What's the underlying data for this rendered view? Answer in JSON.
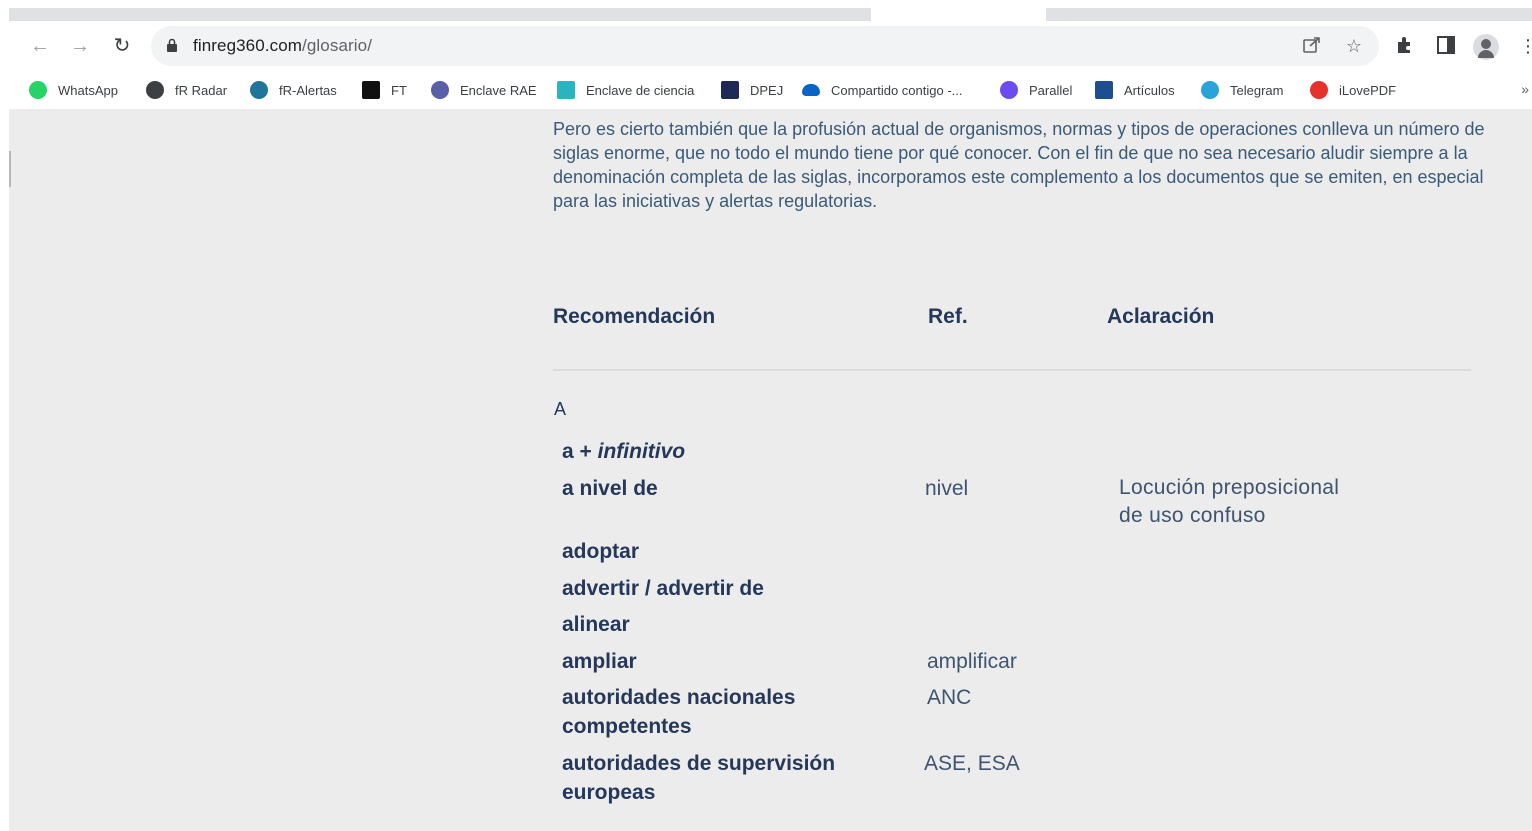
{
  "browser": {
    "url_domain": "finreg360.com",
    "url_path": "/glosario/"
  },
  "bookmarks": [
    {
      "label": "WhatsApp",
      "icon": "whatsapp-icon",
      "color": "#25d366"
    },
    {
      "label": "fR Radar",
      "icon": "globe-icon",
      "color": "#3c4043"
    },
    {
      "label": "fR-Alertas",
      "icon": "wordpress-icon",
      "color": "#21759b"
    },
    {
      "label": "FT",
      "icon": "ft-icon",
      "color": "#111111"
    },
    {
      "label": "Enclave RAE",
      "icon": "rae-icon",
      "color": "#5b5fa8"
    },
    {
      "label": "Enclave de ciencia",
      "icon": "ciencia-icon",
      "color": "#2bb3c0"
    },
    {
      "label": "DPEJ",
      "icon": "dpej-icon",
      "color": "#1e2a55"
    },
    {
      "label": "Compartido contigo -...",
      "icon": "onedrive-icon",
      "color": "#0a64c8"
    },
    {
      "label": "Parallel",
      "icon": "parallel-icon",
      "color": "#6c4cf0"
    },
    {
      "label": "Artículos",
      "icon": "articulos-icon",
      "color": "#1d4e8f"
    },
    {
      "label": "Telegram",
      "icon": "telegram-icon",
      "color": "#2aa3d9"
    },
    {
      "label": "iLovePDF",
      "icon": "ilovepdf-icon",
      "color": "#e5322d"
    }
  ],
  "page": {
    "intro": "Pero es cierto también que la profusión actual de organismos, normas y tipos de operaciones conlleva un número de siglas enorme, que no todo el mundo tiene por qué conocer. Con el fin de que no sea necesario aludir siempre a la denominación completa de las siglas, incorporamos este complemento a los documentos que se emiten, en especial para las iniciativas y alertas regulatorias.",
    "table_headers": {
      "recomendacion": "Recomendación",
      "ref": "Ref.",
      "aclaracion": "Aclaración"
    },
    "section_letter": "A",
    "rows": [
      {
        "term_a": "a + ",
        "term_b": "infinitivo",
        "ref": "",
        "aclaracion_1": "",
        "aclaracion_2": ""
      },
      {
        "term_1": "a nivel de",
        "ref": "nivel",
        "aclaracion_1": "Locución preposicional",
        "aclaracion_2": "de uso confuso"
      },
      {
        "term_1": "adoptar",
        "ref": ""
      },
      {
        "term_1": "advertir / advertir de",
        "ref": ""
      },
      {
        "term_1": "alinear",
        "ref": ""
      },
      {
        "term_1": "ampliar",
        "ref": "amplificar"
      },
      {
        "term_1": "autoridades nacionales",
        "term_2": "competentes",
        "ref": "ANC"
      },
      {
        "term_1": "autoridades de supervisión",
        "term_2": "europeas",
        "ref": "ASE, ESA"
      }
    ]
  }
}
